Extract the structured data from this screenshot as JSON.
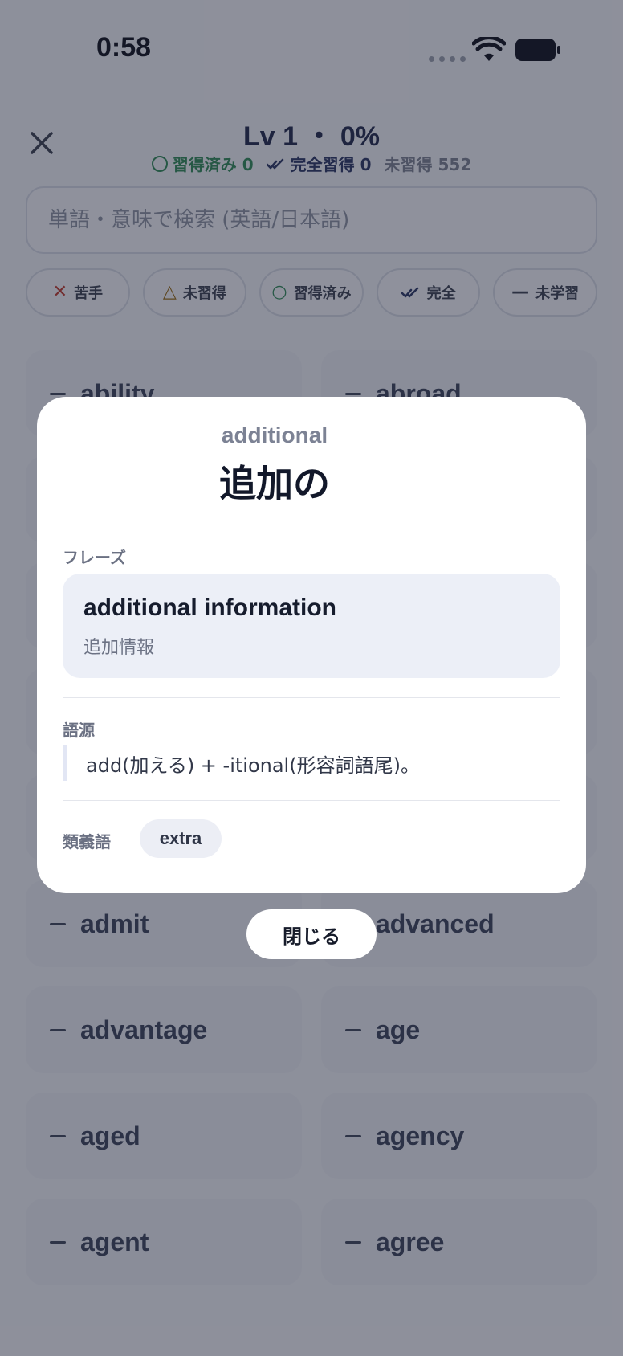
{
  "status_bar": {
    "time": "0:58"
  },
  "header": {
    "level": "Lv 1 ・ 0%",
    "stats": {
      "acquired": "習得済み 0",
      "mastered": "完全習得 0",
      "unacquired": "未習得 552"
    }
  },
  "search": {
    "placeholder": "単語・意味で検索 (英語/日本語)"
  },
  "filters": [
    {
      "label": "苦手",
      "icon": "x-icon",
      "color": "#c0392b"
    },
    {
      "label": "未習得",
      "icon": "triangle-icon",
      "color": "#9a6a10"
    },
    {
      "label": "習得済み",
      "icon": "circle-icon",
      "color": "#2f8a55"
    },
    {
      "label": "完全",
      "icon": "double-check-icon",
      "color": "#2a3563"
    },
    {
      "label": "未学習",
      "icon": "dash-icon",
      "color": "#3a4050"
    }
  ],
  "words": [
    "ability",
    "abroad",
    "admit",
    "advanced",
    "advantage",
    "age",
    "aged",
    "agency",
    "agent",
    "agree"
  ],
  "modal": {
    "word": "additional",
    "meaning": "追加の",
    "phrase_label": "フレーズ",
    "phrase_en": "additional information",
    "phrase_jp": "追加情報",
    "etymology_label": "語源",
    "etymology": "add(加える) + -itional(形容詞語尾)。",
    "synonyms_label": "類義語",
    "synonyms": [
      "extra"
    ]
  },
  "close_button": "閉じる",
  "colors": {
    "overlay": "rgba(30,34,52,0.48)",
    "accent_green": "#2f8a55",
    "accent_navy": "#2a3563"
  }
}
